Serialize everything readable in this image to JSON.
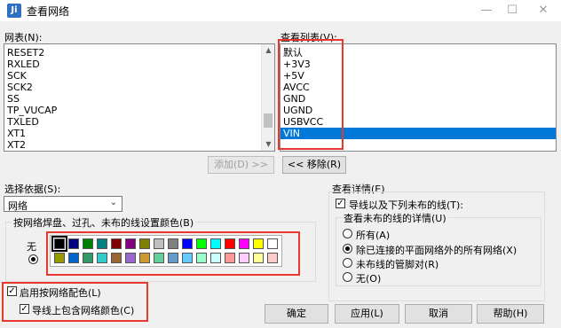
{
  "window": {
    "title": "查看网络",
    "icon_letter": "Ji"
  },
  "nets": {
    "label": "网表(N):",
    "items": [
      "RESET2",
      "RXLED",
      "SCK",
      "SCK2",
      "SS",
      "TP_VUCAP",
      "TXLED",
      "XT1",
      "XT2"
    ]
  },
  "view_list": {
    "label": "查看列表(V):",
    "items": [
      "默认",
      "+3V3",
      "+5V",
      "AVCC",
      "GND",
      "UGND",
      "USBVCC",
      "VIN"
    ],
    "selected": "VIN"
  },
  "buttons": {
    "add": "添加(D) >>",
    "remove": "<< 移除(R)",
    "ok": "确定",
    "apply": "应用(L)",
    "cancel": "取消",
    "help": "帮助(H)"
  },
  "selection": {
    "label": "选择依据(S):",
    "value": "网络"
  },
  "color_group": {
    "title": "按网络焊盘、过孔、未布的线设置颜色(B)",
    "none_label": "无"
  },
  "colors": {
    "row1": [
      "#000000",
      "#000080",
      "#008000",
      "#008080",
      "#800000",
      "#800080",
      "#808000",
      "#c0c0c0",
      "#808080",
      "#0000ff",
      "#00ff00",
      "#00ffff",
      "#ff0000",
      "#ff00ff",
      "#ffff00",
      "#ffffff"
    ],
    "row2": [
      "#999900",
      "#0066cc",
      "#339966",
      "#33cccc",
      "#996633",
      "#9966cc",
      "#cc9933",
      "#66cc99",
      "#6699cc",
      "#66ccff",
      "#99ffcc",
      "#ccffff",
      "#ff9999",
      "#ffccff",
      "#ffff99",
      "#ffcccc"
    ],
    "selected_index": 0
  },
  "options": {
    "enable_net_color": "启用按网络配色(L)",
    "include_net_color": "导线上包含网络颜色(C)"
  },
  "details": {
    "title": "查看详情(E)",
    "show_traces": "导线以及下列未布的线(T):",
    "unrouted_title": "查看未布的线的详情(U)",
    "radios": [
      "所有(A)",
      "除已连接的平面网络外的所有网络(X)",
      "未布线的管脚对(R)",
      "无(O)"
    ],
    "selected_radio": 1
  }
}
